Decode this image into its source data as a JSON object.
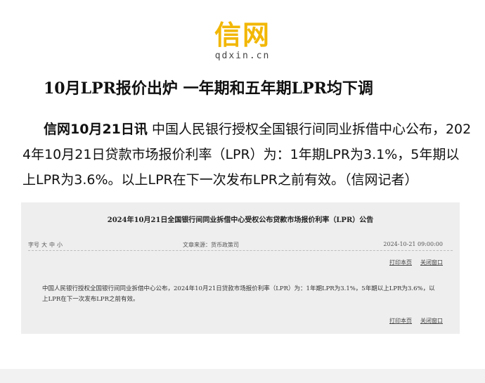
{
  "logo": {
    "mark": "信网",
    "domain": "qdxin.cn",
    "color": "#f2b705"
  },
  "article": {
    "headline": "10月LPR报价出炉 一年期和五年期LPR均下调",
    "lead": "信网10月21日讯",
    "body": "中国人民银行授权全国银行间同业拆借中心公布，2024年10月21日贷款市场报价利率（LPR）为：1年期LPR为3.1%，5年期以上LPR为3.6%。以上LPR在下一次发布LPR之前有效。（信网记者）"
  },
  "notice": {
    "title": "2024年10月21日全国银行间同业拆借中心受权公布贷款市场报价利率（LPR）公告",
    "font_size_label": "字号",
    "size_large": "大",
    "size_medium": "中",
    "size_small": "小",
    "source": "文章来源：货币政策司",
    "datetime": "2024-10-21 09:00:00",
    "print_label": "打印本页",
    "close_label": "关闭窗口",
    "body": "中国人民银行授权全国银行间同业拆借中心公布，2024年10月21日贷款市场报价利率（LPR）为：1年期LPR为3.1%，5年期以上LPR为3.6%，以上LPR在下一次发布LPR之前有效。"
  }
}
